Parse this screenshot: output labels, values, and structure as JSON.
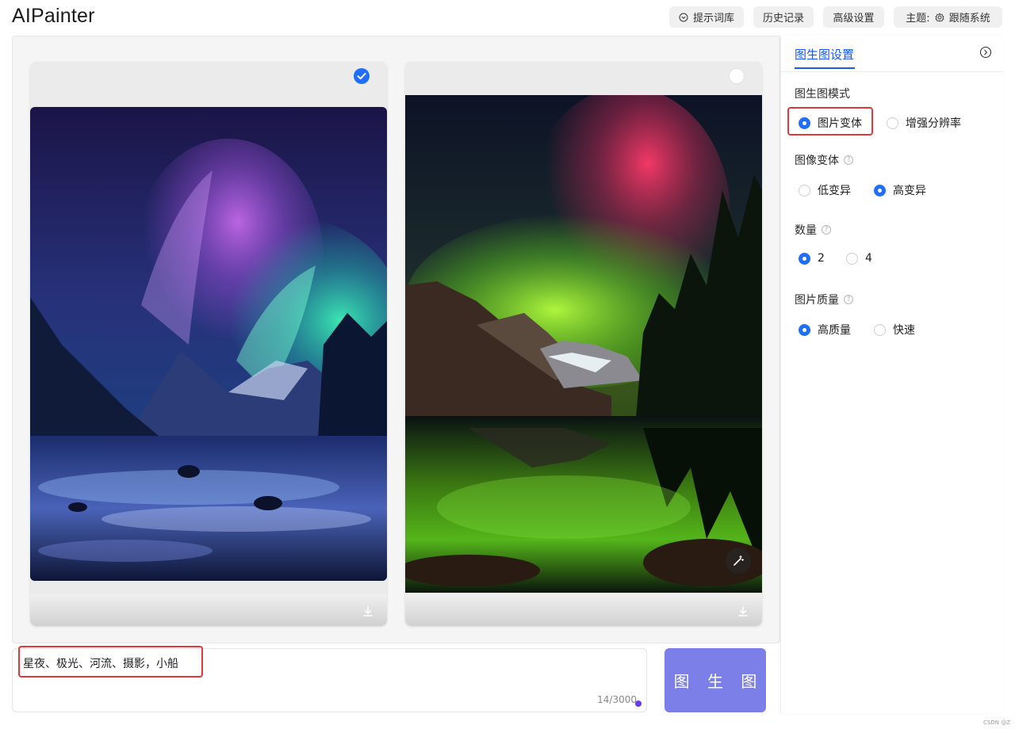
{
  "app": {
    "title": "AIPainter"
  },
  "header": {
    "prompt_library": "提示词库",
    "history": "历史记录",
    "advanced": "高级设置",
    "theme_label": "主题:",
    "theme_value": "跟随系统"
  },
  "images": [
    {
      "selected": true,
      "alt": "aurora-river-image"
    },
    {
      "selected": false,
      "alt": "aurora-lake-image"
    }
  ],
  "prompt": {
    "text": "星夜、极光、河流、摄影，小船",
    "counter": "14/3000"
  },
  "generate_button": "图 生 图",
  "panel": {
    "tab": "图生图设置",
    "mode": {
      "title": "图生图模式",
      "options": [
        "图片变体",
        "增强分辨率"
      ],
      "selected": 0
    },
    "variation": {
      "title": "图像变体",
      "options": [
        "低变异",
        "高变异"
      ],
      "selected": 1
    },
    "count": {
      "title": "数量",
      "options": [
        "2",
        "4"
      ],
      "selected": 0
    },
    "quality": {
      "title": "图片质量",
      "options": [
        "高质量",
        "快速"
      ],
      "selected": 0
    }
  },
  "colors": {
    "accent": "#1f6fff",
    "generate": "#7d7fe8",
    "highlight": "#e2383b"
  },
  "watermark": "CSDN @Z"
}
